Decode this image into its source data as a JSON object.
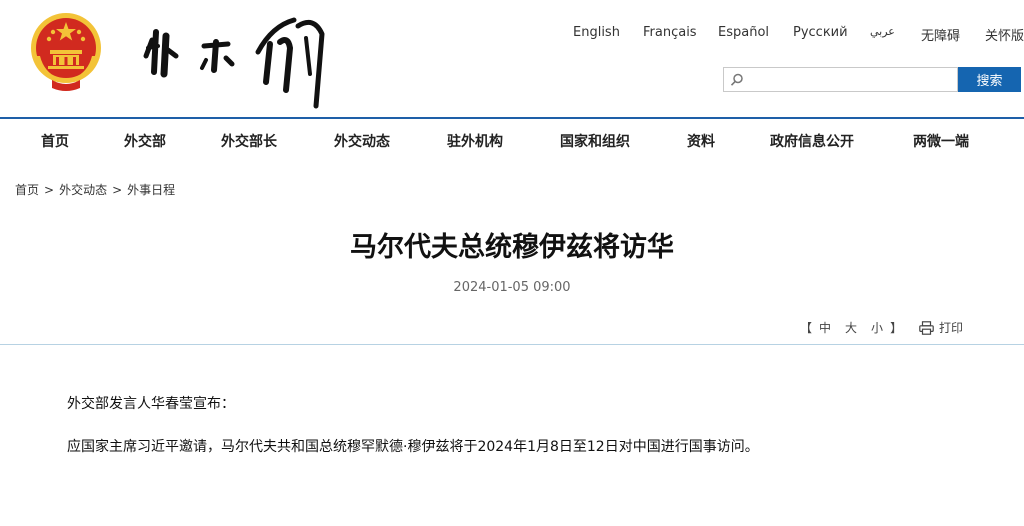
{
  "header": {
    "emblem_icon": "national-emblem-icon",
    "logo_icon": "ministry-calligraphy-logo-icon",
    "languages": [
      "English",
      "Français",
      "Español",
      "Русский",
      "عربي",
      "无障碍",
      "关怀版"
    ]
  },
  "search": {
    "placeholder": "",
    "value": "",
    "button_label": "搜索",
    "icon": "search-icon"
  },
  "nav": {
    "items": [
      "首页",
      "外交部",
      "外交部长",
      "外交动态",
      "驻外机构",
      "国家和组织",
      "资料",
      "政府信息公开",
      "两微一端"
    ]
  },
  "breadcrumb": {
    "items": [
      "首页",
      "外交动态",
      "外事日程"
    ],
    "separator": ">"
  },
  "article": {
    "title": "马尔代夫总统穆伊兹将访华",
    "date": "2024-01-05 09:00",
    "paragraphs": [
      "外交部发言人华春莹宣布：",
      "应国家主席习近平邀请，马尔代夫共和国总统穆罕默德·穆伊兹将于2024年1月8日至12日对中国进行国事访问。"
    ]
  },
  "tools": {
    "bracket_open": "【",
    "bracket_close": "】",
    "font_sizes": [
      "中",
      "大",
      "小"
    ],
    "print_label": "打印",
    "print_icon": "printer-icon"
  },
  "colors": {
    "accent": "#1565b0",
    "nav_line": "#1e5fa8",
    "divider": "#b7d2e3",
    "emblem_red": "#d12a1f",
    "emblem_gold": "#f3c338"
  }
}
